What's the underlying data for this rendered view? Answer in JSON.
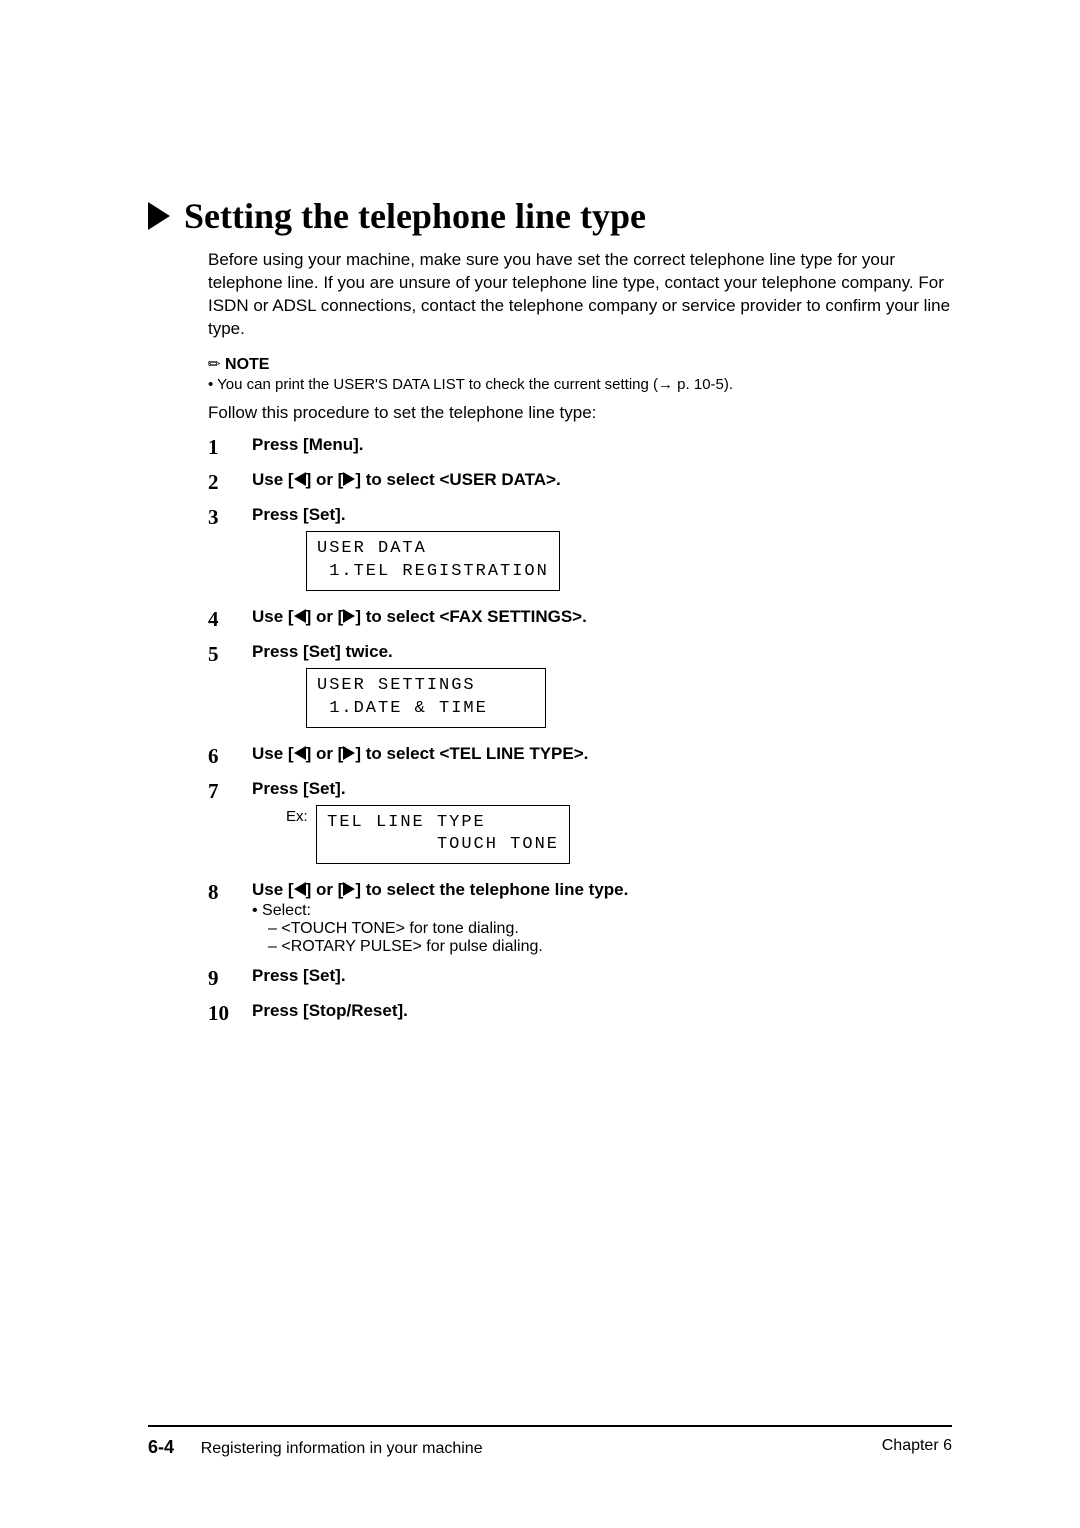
{
  "title": "Setting the telephone line type",
  "intro": "Before using your machine, make sure you have set the correct telephone line type for your telephone line. If you are unsure of your telephone line type, contact your telephone company. For ISDN or ADSL connections, contact the telephone company or service provider to confirm your line type.",
  "note": {
    "label": "NOTE",
    "text": "You can print the USER'S DATA LIST to check the current setting (→ p. 10-5)."
  },
  "follow": "Follow this procedure to set the telephone line type:",
  "steps": {
    "s1": "Press [Menu].",
    "s2_a": "Use [",
    "s2_b": "] or [",
    "s2_c": "] to select <USER DATA>.",
    "s3": "Press [Set].",
    "s4_a": "Use [",
    "s4_b": "] or [",
    "s4_c": "] to select <FAX SETTINGS>.",
    "s5": "Press [Set] twice.",
    "s6_a": "Use [",
    "s6_b": "] or [",
    "s6_c": "] to select <TEL LINE TYPE>.",
    "s7": "Press [Set].",
    "s7_ex": "Ex:",
    "s8_a": "Use [",
    "s8_b": "] or [",
    "s8_c": "] to select the telephone line type.",
    "s8_sel": "Select:",
    "s8_opt1": "– <TOUCH TONE> for tone dialing.",
    "s8_opt2": "– <ROTARY PULSE> for pulse dialing.",
    "s9": "Press [Set].",
    "s10": "Press [Stop/Reset]."
  },
  "lcd": {
    "d1": "USER DATA\n 1.TEL REGISTRATION",
    "d2": "USER SETTINGS\n 1.DATE & TIME",
    "d3": "TEL LINE TYPE\n         TOUCH TONE"
  },
  "footer": {
    "page": "6-4",
    "left": "Registering information in your machine",
    "right": "Chapter 6"
  }
}
